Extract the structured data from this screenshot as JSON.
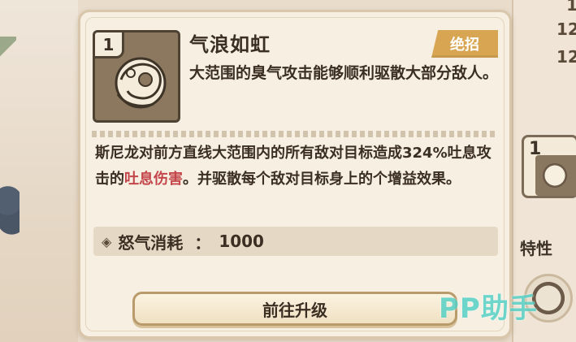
{
  "skill": {
    "level": "1",
    "name": "气浪如虹",
    "badge": "绝招",
    "short_desc": "大范围的臭气攻击能够顺利驱散大部分敌人。",
    "desc_part1": "斯尼龙对前方直线大范围内的所有敌对目标造成324%吐息攻击的",
    "desc_highlight": "吐息伤害",
    "desc_part2": "。并驱散每个敌对目标身上的个增益效果。",
    "cost_label": "怒气消耗",
    "cost_sep": "：",
    "cost_value": "1000"
  },
  "upgrade_button": {
    "label": "前往升级"
  },
  "side_panel": {
    "numbers": [
      "1",
      "12",
      "12"
    ],
    "thumb_level": "1",
    "trait_label": "特性"
  },
  "watermark": "PP助手",
  "colors": {
    "highlight": "#c4464a",
    "badge": "#d8a653",
    "watermark": "#57d1c6"
  }
}
